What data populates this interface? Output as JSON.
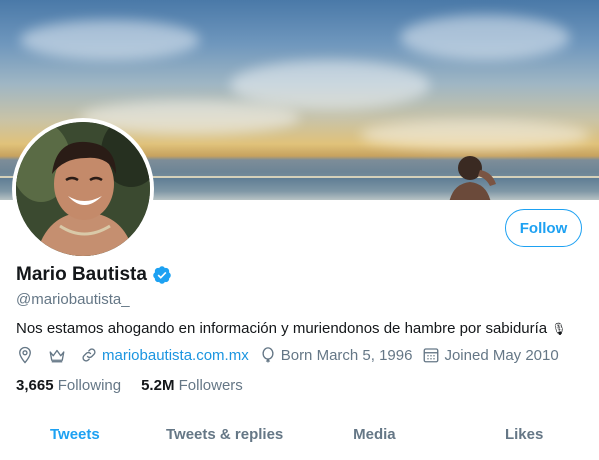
{
  "profile": {
    "display_name": "Mario Bautista",
    "handle": "@mariobautista_",
    "bio": "Nos estamos ahogando en información y muriendonos de hambre por sabiduría",
    "bio_emoji": "🎙",
    "website": "mariobautista.com.mx",
    "born": "Born March 5, 1996",
    "joined": "Joined May 2010",
    "following_count": "3,665",
    "following_label": "Following",
    "followers_count": "5.2M",
    "followers_label": "Followers"
  },
  "actions": {
    "follow_label": "Follow"
  },
  "tabs": [
    {
      "label": "Tweets",
      "active": true
    },
    {
      "label": "Tweets & replies",
      "active": false
    },
    {
      "label": "Media",
      "active": false
    },
    {
      "label": "Likes",
      "active": false
    }
  ],
  "icons": {
    "location": "location-pin-icon",
    "crown": "crown-icon",
    "link": "link-icon",
    "birthday": "balloon-icon",
    "calendar": "calendar-icon",
    "verified": "verified-badge-icon"
  },
  "colors": {
    "accent": "#1da1f2",
    "link": "#1b95e0",
    "muted": "#657786",
    "text": "#14171a"
  }
}
